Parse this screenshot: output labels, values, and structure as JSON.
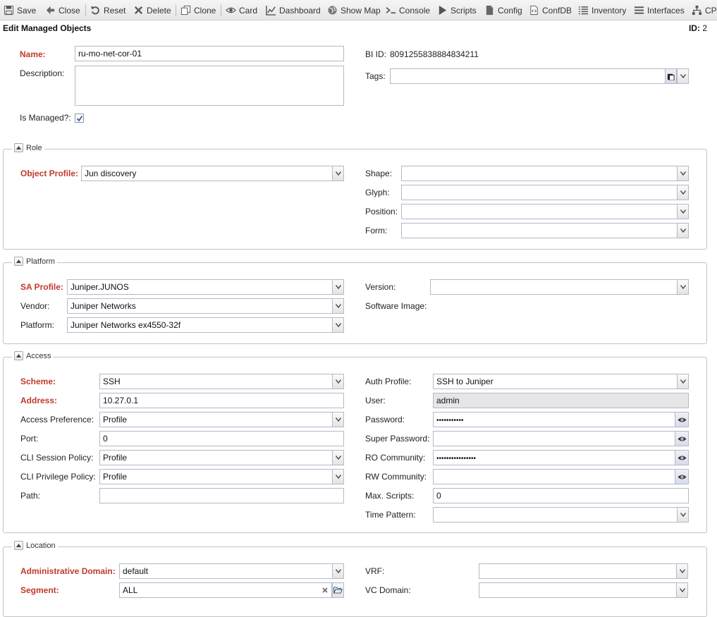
{
  "toolbar": {
    "save": "Save",
    "close": "Close",
    "reset": "Reset",
    "delete": "Delete",
    "clone": "Clone",
    "card": "Card",
    "dashboard": "Dashboard",
    "show_map": "Show Map",
    "console": "Console",
    "scripts": "Scripts",
    "config": "Config",
    "confdb": "ConfDB",
    "inventory": "Inventory",
    "interfaces": "Interfaces",
    "cpe": "CPE"
  },
  "header": {
    "title": "Edit Managed Objects",
    "id_label": "ID:",
    "id_value": "2"
  },
  "general": {
    "name_label": "Name:",
    "name_value": "ru-mo-net-cor-01",
    "description_label": "Description:",
    "description_value": "",
    "is_managed_label": "Is Managed?:",
    "is_managed": true,
    "bi_id_label": "BI ID:",
    "bi_id_value": "8091255838884834211",
    "tags_label": "Tags:",
    "tags_value": ""
  },
  "role": {
    "legend": "Role",
    "object_profile_label": "Object Profile:",
    "object_profile_value": "Jun discovery",
    "shape_label": "Shape:",
    "shape_value": "",
    "glyph_label": "Glyph:",
    "glyph_value": "",
    "position_label": "Position:",
    "position_value": "",
    "form_label": "Form:",
    "form_value": ""
  },
  "platform": {
    "legend": "Platform",
    "sa_profile_label": "SA Profile:",
    "sa_profile_value": "Juniper.JUNOS",
    "vendor_label": "Vendor:",
    "vendor_value": "Juniper Networks",
    "platform_label": "Platform:",
    "platform_value": "Juniper Networks ex4550-32f",
    "version_label": "Version:",
    "version_value": "",
    "software_image_label": "Software Image:"
  },
  "access": {
    "legend": "Access",
    "scheme_label": "Scheme:",
    "scheme_value": "SSH",
    "address_label": "Address:",
    "address_value": "10.27.0.1",
    "access_pref_label": "Access Preference:",
    "access_pref_value": "Profile",
    "port_label": "Port:",
    "port_value": "0",
    "cli_session_label": "CLI Session Policy:",
    "cli_session_value": "Profile",
    "cli_privilege_label": "CLI Privilege Policy:",
    "cli_privilege_value": "Profile",
    "path_label": "Path:",
    "path_value": "",
    "auth_profile_label": "Auth Profile:",
    "auth_profile_value": "SSH to Juniper",
    "user_label": "User:",
    "user_value": "admin",
    "password_label": "Password:",
    "password_value": "•••••••••••",
    "super_password_label": "Super Password:",
    "super_password_value": "",
    "ro_community_label": "RO Community:",
    "ro_community_value": "••••••••••••••••",
    "rw_community_label": "RW Community:",
    "rw_community_value": "",
    "max_scripts_label": "Max. Scripts:",
    "max_scripts_value": "0",
    "time_pattern_label": "Time Pattern:",
    "time_pattern_value": ""
  },
  "location": {
    "legend": "Location",
    "admin_domain_label": "Administrative Domain:",
    "admin_domain_value": "default",
    "segment_label": "Segment:",
    "segment_value": "ALL",
    "vrf_label": "VRF:",
    "vrf_value": "",
    "vc_domain_label": "VC Domain:",
    "vc_domain_value": ""
  },
  "colors": {
    "required_label": "#c0392b",
    "toolbar_bg": "#ececec",
    "readonly_field": "#e6e6e6"
  }
}
